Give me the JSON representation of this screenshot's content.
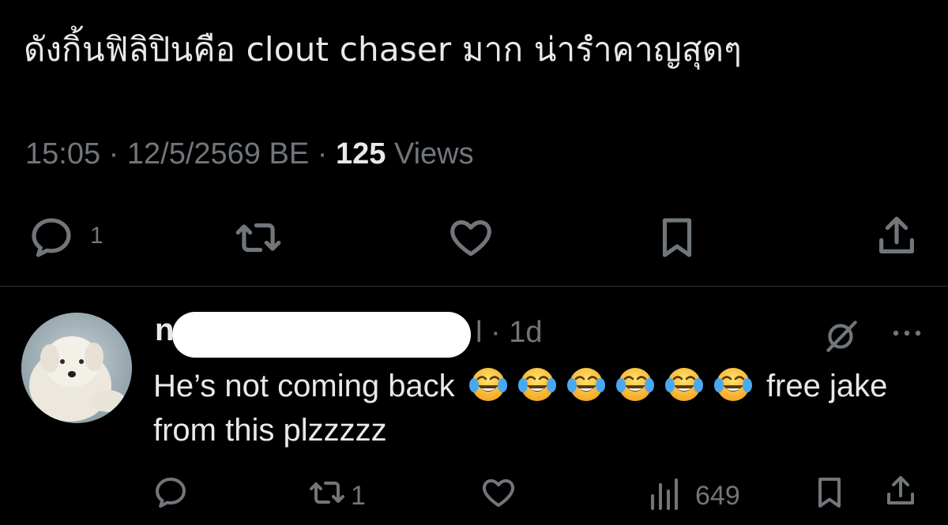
{
  "tweet": {
    "text": "ดังกิ้นฟิลิปินคือ clout chaser มาก น่ารำคาญสุดๆ",
    "time": "15:05",
    "date": "12/5/2569 BE",
    "views_count": "125",
    "views_label": "Views",
    "actions": {
      "reply_count": "1"
    }
  },
  "reply": {
    "name_visible": "n",
    "handle_tail": "l",
    "age": "1d",
    "text_part1": "He’s not coming back",
    "emoji_name": "face-with-tears-of-joy",
    "emoji_count": 6,
    "text_part2": "free jake from this plzzzzz",
    "actions": {
      "retweet_count": "1",
      "views_count": "649"
    }
  },
  "colors": {
    "background": "#000000",
    "text": "#e7e9ea",
    "muted": "#71767b",
    "divider": "#2f3336"
  }
}
